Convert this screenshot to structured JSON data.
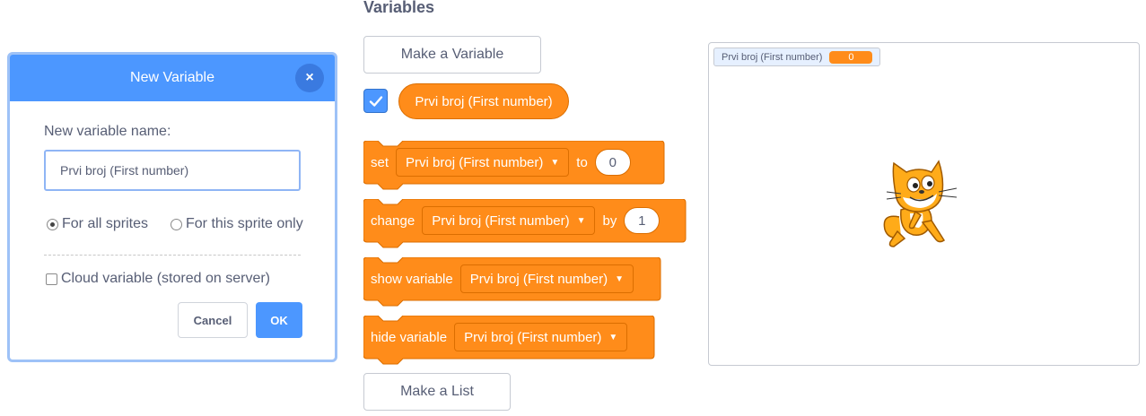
{
  "dialog": {
    "title": "New Variable",
    "close_symbol": "×",
    "name_label": "New variable name:",
    "name_value": "Prvi broj (First number)",
    "radio_all": "For all sprites",
    "radio_this": "For this sprite only",
    "cloud_label": "Cloud variable (stored on server)",
    "cancel": "Cancel",
    "ok": "OK"
  },
  "palette": {
    "title": "Variables",
    "make_variable": "Make a Variable",
    "make_list": "Make a List",
    "variable_name": "Prvi broj (First number)",
    "blocks": {
      "set": {
        "keyword": "set",
        "var": "Prvi broj (First number)",
        "connector": "to",
        "value": "0"
      },
      "change": {
        "keyword": "change",
        "var": "Prvi broj (First number)",
        "connector": "by",
        "value": "1"
      },
      "show": {
        "keyword": "show variable",
        "var": "Prvi broj (First number)"
      },
      "hide": {
        "keyword": "hide variable",
        "var": "Prvi broj (First number)"
      }
    },
    "colors": {
      "block": "#ff8c1a",
      "block_border": "#db6e00",
      "accent": "#4c97ff"
    }
  },
  "stage": {
    "monitor_label": "Prvi broj (First number)",
    "monitor_value": "0",
    "sprite": "cat-sprite-icon"
  }
}
